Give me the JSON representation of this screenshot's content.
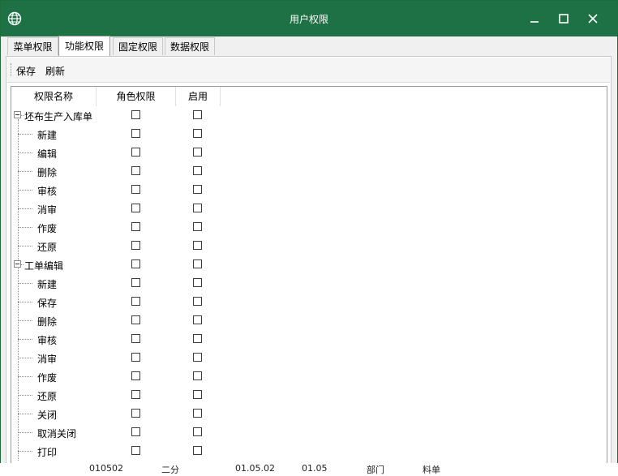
{
  "window": {
    "title": "用户权限"
  },
  "tabs": [
    {
      "label": "菜单权限",
      "active": false
    },
    {
      "label": "功能权限",
      "active": true
    },
    {
      "label": "固定权限",
      "active": false
    },
    {
      "label": "数据权限",
      "active": false
    }
  ],
  "toolbar": {
    "save_label": "保存",
    "refresh_label": "刷新"
  },
  "columns": {
    "name": "权限名称",
    "role": "角色权限",
    "enabled": "启用"
  },
  "tree": [
    {
      "label": "坯布生产入库单",
      "level": 0,
      "expanded": true,
      "role": false,
      "enabled": false
    },
    {
      "label": "新建",
      "level": 1,
      "role": false,
      "enabled": false
    },
    {
      "label": "编辑",
      "level": 1,
      "role": false,
      "enabled": false
    },
    {
      "label": "删除",
      "level": 1,
      "role": false,
      "enabled": false
    },
    {
      "label": "审核",
      "level": 1,
      "role": false,
      "enabled": false
    },
    {
      "label": "消审",
      "level": 1,
      "role": false,
      "enabled": false
    },
    {
      "label": "作废",
      "level": 1,
      "role": false,
      "enabled": false
    },
    {
      "label": "还原",
      "level": 1,
      "role": false,
      "enabled": false
    },
    {
      "label": "工单编辑",
      "level": 0,
      "expanded": true,
      "role": false,
      "enabled": false
    },
    {
      "label": "新建",
      "level": 1,
      "role": false,
      "enabled": false
    },
    {
      "label": "保存",
      "level": 1,
      "role": false,
      "enabled": false
    },
    {
      "label": "删除",
      "level": 1,
      "role": false,
      "enabled": false
    },
    {
      "label": "审核",
      "level": 1,
      "role": false,
      "enabled": false
    },
    {
      "label": "消审",
      "level": 1,
      "role": false,
      "enabled": false
    },
    {
      "label": "作废",
      "level": 1,
      "role": false,
      "enabled": false
    },
    {
      "label": "还原",
      "level": 1,
      "role": false,
      "enabled": false
    },
    {
      "label": "关闭",
      "level": 1,
      "role": false,
      "enabled": false
    },
    {
      "label": "取消关闭",
      "level": 1,
      "role": false,
      "enabled": false
    },
    {
      "label": "打印",
      "level": 1,
      "role": false,
      "enabled": false
    }
  ],
  "background_row": [
    "010502",
    "二分",
    "01.05.02",
    "01.05",
    "部门",
    "料单"
  ],
  "colors": {
    "titlebar": "#1e7145",
    "border": "#9a9a9a"
  }
}
